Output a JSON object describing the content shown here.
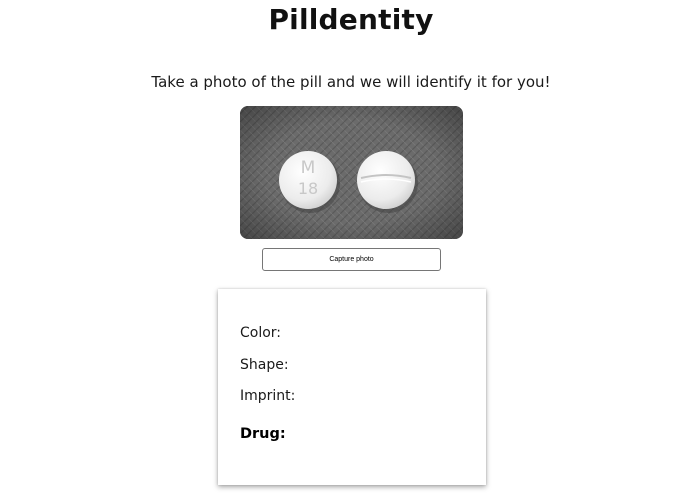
{
  "app": {
    "title": "Pilldentity",
    "subtitle": "Take a photo of the pill and we will identify it for you!"
  },
  "photo": {
    "pills": [
      {
        "imprint_top": "M",
        "imprint_bottom": "18",
        "type": "imprinted"
      },
      {
        "type": "scored"
      }
    ],
    "colors": {
      "background": "#6a6a6a",
      "pill": "#f2f2f2"
    }
  },
  "capture": {
    "label": "Capture photo"
  },
  "result": {
    "color_label": "Color:",
    "shape_label": "Shape:",
    "imprint_label": "Imprint:",
    "drug_label": "Drug:"
  }
}
